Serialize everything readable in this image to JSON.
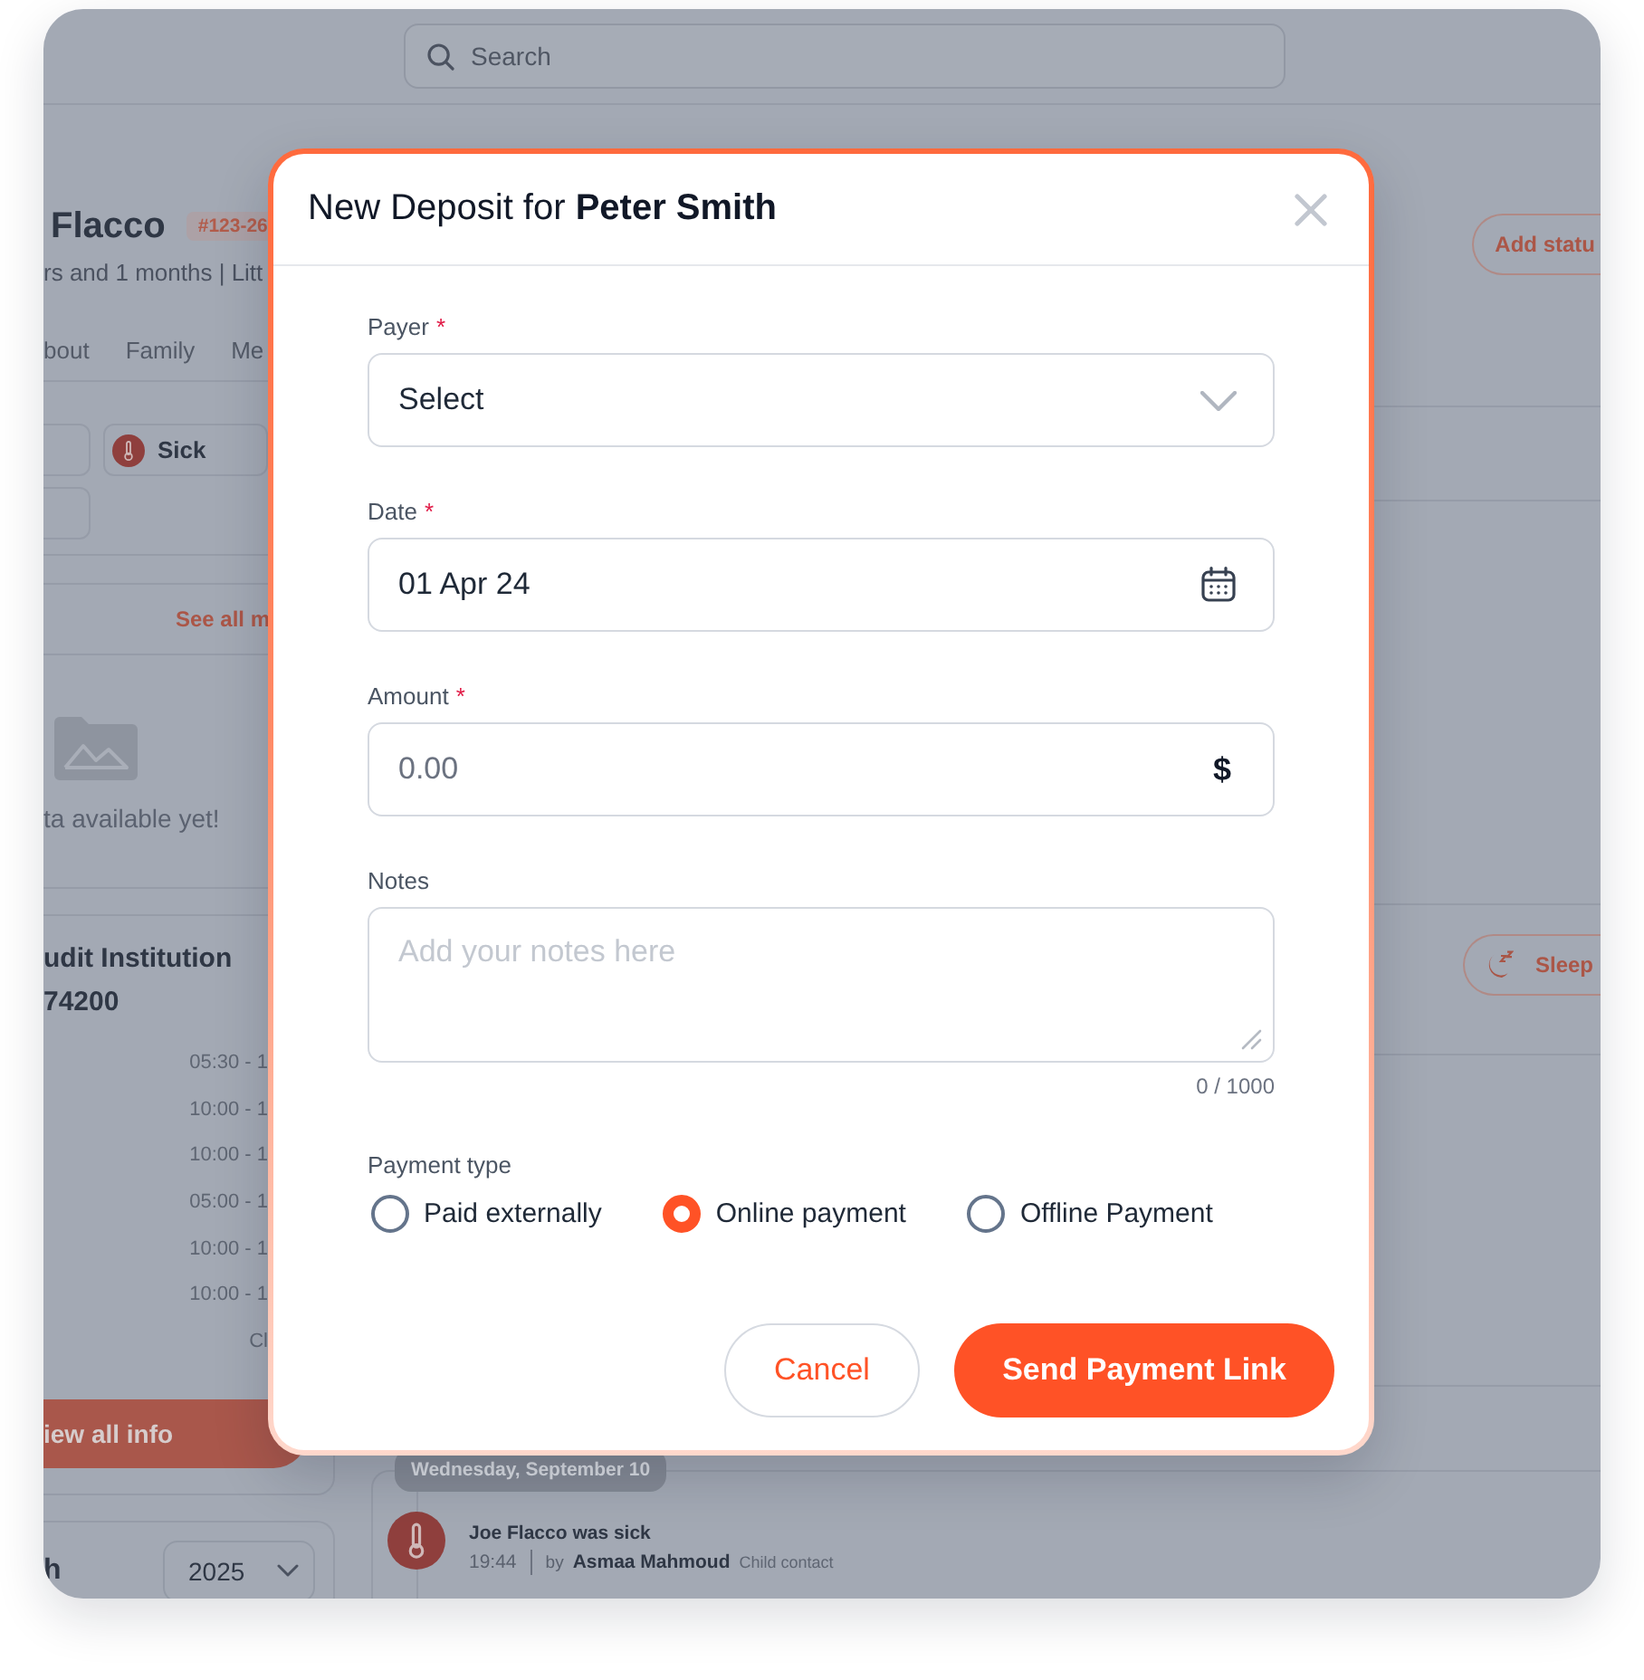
{
  "search": {
    "placeholder": "Search"
  },
  "profile": {
    "name": "Flacco",
    "badge": "#123-26",
    "subtitle": "rs and 1 months | Litt",
    "status_button": "Add statu"
  },
  "profile_tabs": [
    {
      "label": "bout",
      "selected": false
    },
    {
      "label": "Family",
      "selected": false
    },
    {
      "label": "Me",
      "selected": false
    }
  ],
  "status_chips": [
    {
      "kind": "blank"
    },
    {
      "kind": "status",
      "label": "Sick"
    },
    {
      "kind": "blank"
    }
  ],
  "media": {
    "link": "See all m",
    "empty_text": "ta available yet!"
  },
  "institution": {
    "name": "udit Institution",
    "number": "74200",
    "hours": [
      "05:30 - 1",
      "10:00 - 1",
      "10:00 - 1",
      "05:00 - 1",
      "10:00 - 1",
      "10:00 - 1",
      "Cl"
    ],
    "button": "iew all info"
  },
  "year_card": {
    "title": "h",
    "year": "2025"
  },
  "sleep_button": "Sleep",
  "timeline": {
    "date": "Wednesday, September 10",
    "entries": [
      {
        "title": "Joe Flacco was sick",
        "time": "19:44",
        "by": "by",
        "author": "Asmaa Mahmoud",
        "role": "Child contact"
      }
    ]
  },
  "dialog": {
    "title": "New Deposit for **Peter Smith**",
    "fields": [
      {
        "kind": "select",
        "label": "Payer",
        "required_mark": "*",
        "placeholder": "Select"
      },
      {
        "kind": "date",
        "label": "Date",
        "required_mark": "*",
        "value": "01 Apr 24"
      },
      {
        "kind": "amount",
        "label": "Amount",
        "required_mark": "*",
        "placeholder": "0.00",
        "suffix": "$"
      },
      {
        "kind": "textarea",
        "label": "Notes",
        "placeholder": "Add your notes here",
        "counter": "0 / 1000"
      }
    ],
    "payment_type": {
      "label": "Payment type",
      "options": [
        {
          "label": "Paid externally",
          "selected": false
        },
        {
          "label": "Online payment",
          "selected": true
        },
        {
          "label": "Offline Payment",
          "selected": false
        }
      ]
    },
    "buttons": [
      {
        "kind": "secondary",
        "label": "Cancel"
      },
      {
        "kind": "primary",
        "label": "Send Payment Link"
      }
    ]
  }
}
